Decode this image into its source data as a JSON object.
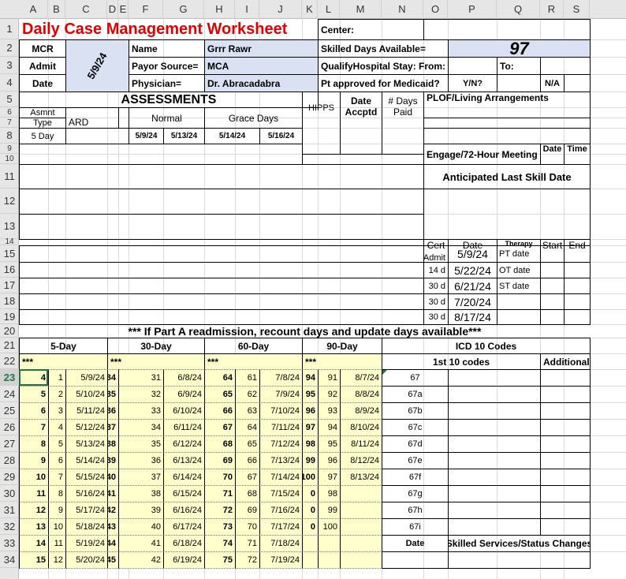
{
  "columns": [
    "A",
    "B",
    "C",
    "D",
    "E",
    "F",
    "G",
    "H",
    "I",
    "J",
    "K",
    "L",
    "M",
    "N",
    "O",
    "P",
    "Q",
    "R",
    "S"
  ],
  "rows": [
    "1",
    "2",
    "3",
    "4",
    "5",
    "6",
    "7",
    "8",
    "9",
    "10",
    "11",
    "12",
    "13",
    "14",
    "15",
    "16",
    "17",
    "18",
    "19",
    "20",
    "21",
    "22",
    "23",
    "24",
    "25",
    "26",
    "27",
    "28",
    "29",
    "30",
    "31",
    "32",
    "33",
    "34"
  ],
  "selected_row": "23",
  "title": "Daily Case Management Worksheet",
  "center_label": "Center:",
  "mcr": "MCR",
  "admit": "Admit",
  "date": "Date",
  "date_value": "5/9/24",
  "name_label": "Name",
  "name_value": "Grrr Rawr",
  "payor_label": "Payor Source=",
  "payor_value": "MCA",
  "physician_label": "Physician=",
  "physician_value": "Dr. Abracadabra",
  "skilled_label": "Skilled Days Available=",
  "skilled_value": "97",
  "qualify_label": "QualifyHospital Stay:  From:",
  "to_label": "To:",
  "medicaid_label": "Pt approved for Medicaid?",
  "yn": "Y/N?",
  "na": "N/A",
  "assessments": "ASSESSMENTS",
  "asmnt": "Asmnt",
  "type": "Type",
  "ard": "ARD",
  "normal": "Normal",
  "grace": "Grace Days",
  "hipps": "HIPPS",
  "date_acc": "Date Accptd",
  "days_paid": "# Days Paid",
  "fiveday_label": "5 Day",
  "ard_dates": [
    "5/9/24",
    "5/13/24",
    "5/14/24",
    "5/16/24"
  ],
  "plof": "PLOF/Living Arrangements",
  "engage": "Engage/72-Hour Meeting",
  "date_h": "Date",
  "time_h": "Time",
  "anticipated": "Anticipated Last Skill Date",
  "cert": {
    "header": [
      "Cert",
      "Date",
      "Therapy",
      "Start",
      "End"
    ],
    "rows": [
      [
        "Admit",
        "5/9/24",
        "PT date"
      ],
      [
        "14 d",
        "5/22/24",
        "OT date"
      ],
      [
        "30 d",
        "6/21/24",
        "ST date"
      ],
      [
        "30 d",
        "7/20/24",
        ""
      ],
      [
        "30 d",
        "8/17/24",
        ""
      ]
    ]
  },
  "readmission": "*** If Part A readmission, recount days and update days available***",
  "periods": [
    "5-Day",
    "30-Day",
    "60-Day",
    "90-Day"
  ],
  "stars": "***",
  "icd": {
    "title": "ICD 10 Codes",
    "first": "1st 10 codes",
    "additional": "Additional",
    "codes": [
      "67",
      "67a",
      "67b",
      "67c",
      "67d",
      "67e",
      "67f",
      "67g",
      "67h",
      "67i"
    ]
  },
  "day_rows": [
    [
      "4",
      "1",
      "5/9/24",
      "34",
      "31",
      "6/8/24",
      "64",
      "61",
      "7/8/24",
      "94",
      "91",
      "8/7/24"
    ],
    [
      "5",
      "2",
      "5/10/24",
      "35",
      "32",
      "6/9/24",
      "65",
      "62",
      "7/9/24",
      "95",
      "92",
      "8/8/24"
    ],
    [
      "6",
      "3",
      "5/11/24",
      "36",
      "33",
      "6/10/24",
      "66",
      "63",
      "7/10/24",
      "96",
      "93",
      "8/9/24"
    ],
    [
      "7",
      "4",
      "5/12/24",
      "37",
      "34",
      "6/11/24",
      "67",
      "64",
      "7/11/24",
      "97",
      "94",
      "8/10/24"
    ],
    [
      "8",
      "5",
      "5/13/24",
      "38",
      "35",
      "6/12/24",
      "68",
      "65",
      "7/12/24",
      "98",
      "95",
      "8/11/24"
    ],
    [
      "9",
      "6",
      "5/14/24",
      "39",
      "36",
      "6/13/24",
      "69",
      "66",
      "7/13/24",
      "99",
      "96",
      "8/12/24"
    ],
    [
      "10",
      "7",
      "5/15/24",
      "40",
      "37",
      "6/14/24",
      "70",
      "67",
      "7/14/24",
      "100",
      "97",
      "8/13/24"
    ],
    [
      "11",
      "8",
      "5/16/24",
      "41",
      "38",
      "6/15/24",
      "71",
      "68",
      "7/15/24",
      "0",
      "98",
      ""
    ],
    [
      "12",
      "9",
      "5/17/24",
      "42",
      "39",
      "6/16/24",
      "72",
      "69",
      "7/16/24",
      "0",
      "99",
      ""
    ],
    [
      "13",
      "10",
      "5/18/24",
      "43",
      "40",
      "6/17/24",
      "73",
      "70",
      "7/17/24",
      "0",
      "100",
      ""
    ],
    [
      "14",
      "11",
      "5/19/24",
      "44",
      "41",
      "6/18/24",
      "74",
      "71",
      "7/18/24",
      "",
      "",
      ""
    ],
    [
      "15",
      "12",
      "5/20/24",
      "45",
      "42",
      "6/19/24",
      "75",
      "72",
      "7/19/24",
      "",
      "",
      ""
    ]
  ],
  "date_col": "Date",
  "skilled_services": "Skilled Services/Status Changes"
}
